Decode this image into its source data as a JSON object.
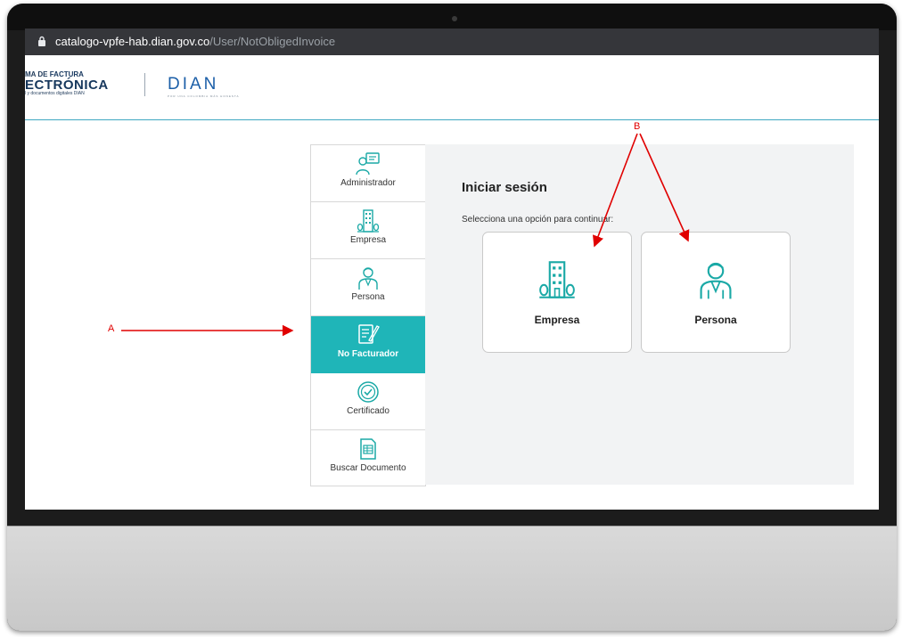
{
  "browser": {
    "url_host": "catalogo-vpfe-hab.dian.gov.co",
    "url_path": "/User/NotObligedInvoice"
  },
  "header": {
    "logo_line1_prefix": "MA DE",
    "logo_line1_bold": "FACTURA",
    "logo_line2": "ECTRÓNICA",
    "logo_line3": "l y documentos digitales DIAN",
    "dian_logo": "DIAN",
    "dian_tagline": "POR UNA COLOMBIA MÁS HONESTA"
  },
  "sidebar": {
    "items": [
      {
        "label": "Administrador",
        "icon": "admin-icon"
      },
      {
        "label": "Empresa",
        "icon": "building-icon"
      },
      {
        "label": "Persona",
        "icon": "person-icon"
      },
      {
        "label": "No Facturador",
        "icon": "document-edit-icon",
        "active": true
      },
      {
        "label": "Certificado",
        "icon": "certificate-icon"
      },
      {
        "label": "Buscar Documento",
        "icon": "search-document-icon"
      }
    ]
  },
  "panel": {
    "title": "Iniciar sesión",
    "subtitle": "Selecciona una opción para continuar:",
    "options": [
      {
        "label": "Empresa",
        "icon": "building-icon"
      },
      {
        "label": "Persona",
        "icon": "person-icon"
      }
    ]
  },
  "annotations": {
    "a_label": "A",
    "b_label": "B"
  },
  "colors": {
    "accent": "#1fb5b8",
    "annotation": "#e00000",
    "icon_teal": "#1aa9a6"
  }
}
